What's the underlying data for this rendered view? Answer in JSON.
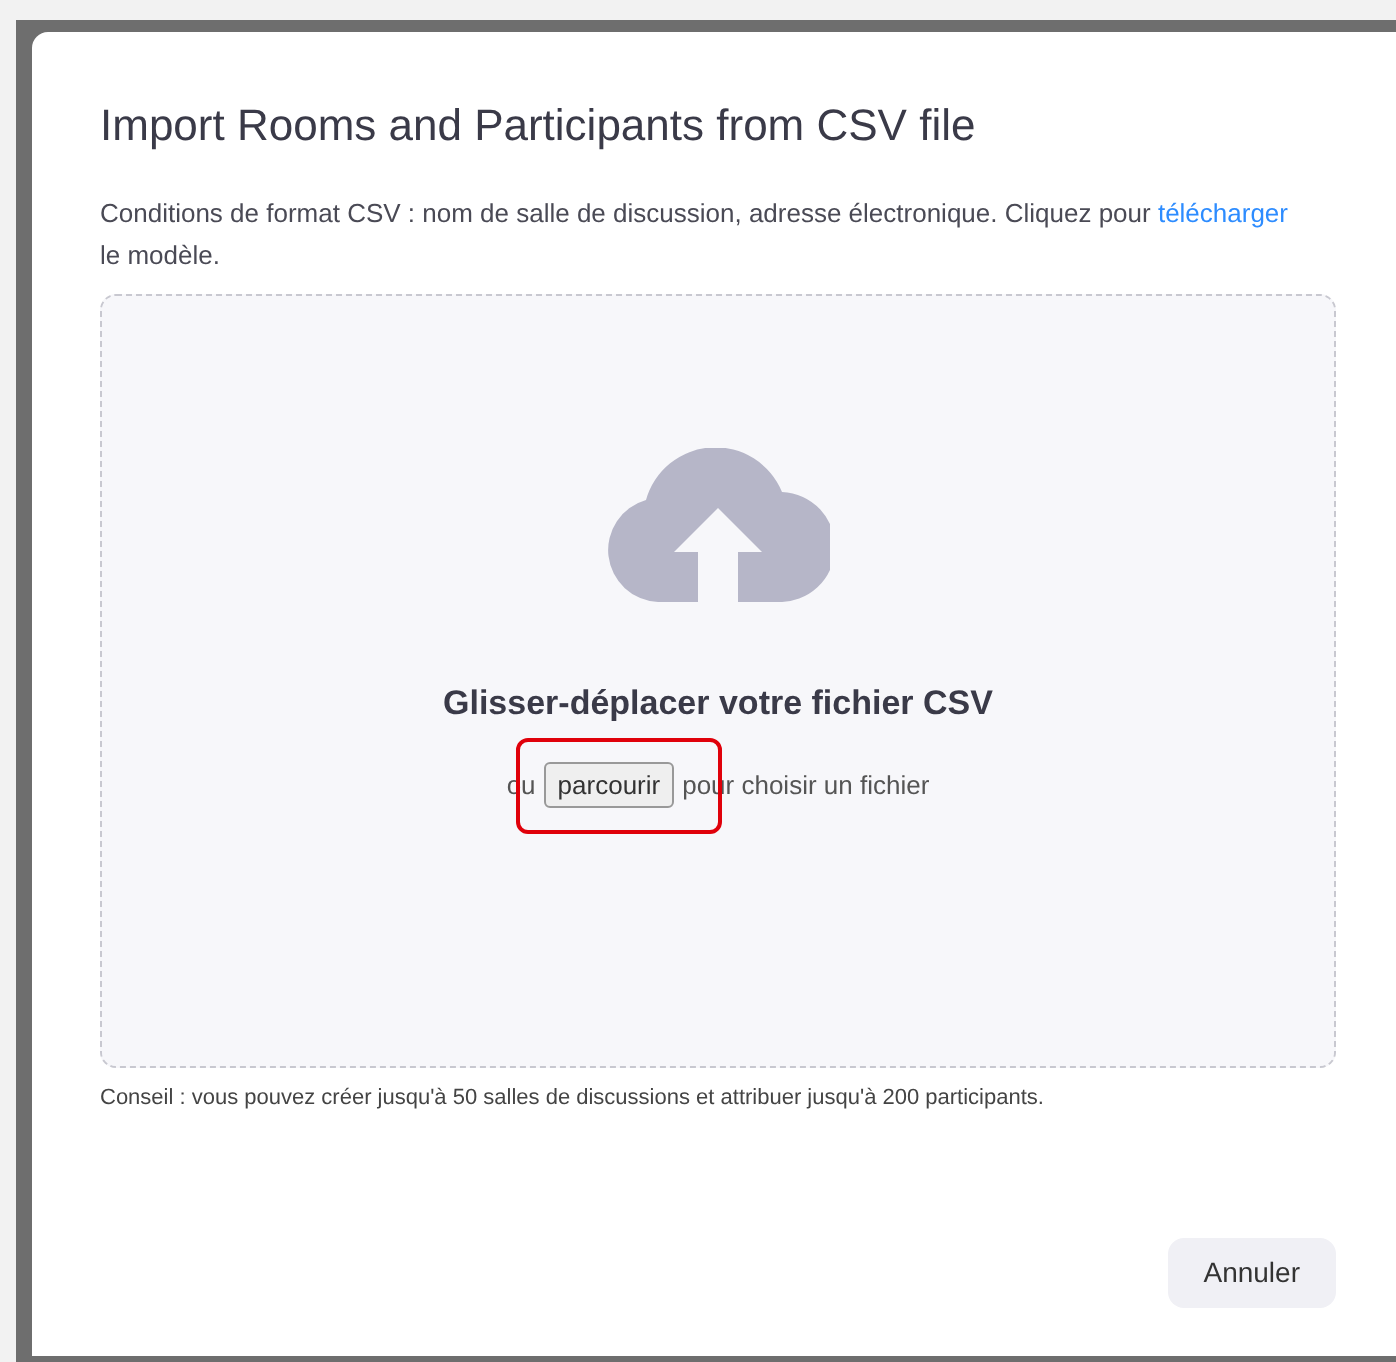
{
  "dialog": {
    "title": "Import Rooms and Participants from CSV file",
    "description": {
      "before": "Conditions de format CSV : nom de salle de discussion, adresse électronique. Cliquez pour",
      "link": "télécharger",
      "after": "le modèle."
    },
    "dropzone": {
      "heading": "Glisser-déplacer votre fichier CSV",
      "prefix": "ou",
      "browse_button": {
        "label": "parcourir",
        "highlighted": true
      },
      "suffix": "pour choisir un fichier"
    },
    "tip": "Conseil : vous pouvez créer jusqu'à 50 salles de discussions et attribuer jusqu'à 200 participants.",
    "buttons": [
      "Annuler"
    ]
  }
}
